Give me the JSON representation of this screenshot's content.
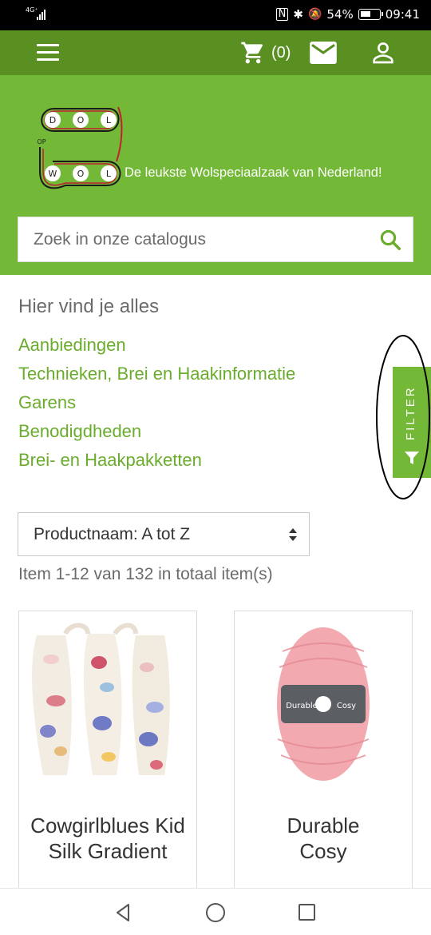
{
  "status_bar": {
    "network": "4G⁺",
    "battery": "54%",
    "time": "09:41"
  },
  "nav": {
    "cart_count": "(0)",
    "icons": [
      "menu-icon",
      "cart-icon",
      "mail-icon",
      "user-icon"
    ]
  },
  "header": {
    "logo_letters": [
      "D",
      "O",
      "L",
      "OP",
      "W",
      "O",
      "L"
    ],
    "tagline": "De leukste Wolspeciaalzaak van Nederland!",
    "search_placeholder": "Zoek in onze catalogus"
  },
  "categories": {
    "heading": "Hier vind je alles",
    "items": [
      "Aanbiedingen",
      "Technieken, Brei en Haakinformatie",
      "Garens",
      "Benodigdheden",
      "Brei- en Haakpakketten"
    ]
  },
  "filter": {
    "label": "FILTER"
  },
  "sort": {
    "selected": "Productnaam: A tot Z"
  },
  "results": {
    "count_text": "Item 1-12 van 132 in totaal item(s)"
  },
  "products": [
    {
      "name": "Cowgirlblues Kid Silk Gradient"
    },
    {
      "name": "Durable Cosy",
      "label_brand": "Durable",
      "label_product": "Cosy"
    }
  ],
  "colors": {
    "nav_green": "#5a8f22",
    "header_green": "#73b836",
    "link_green": "#6aac2c"
  }
}
